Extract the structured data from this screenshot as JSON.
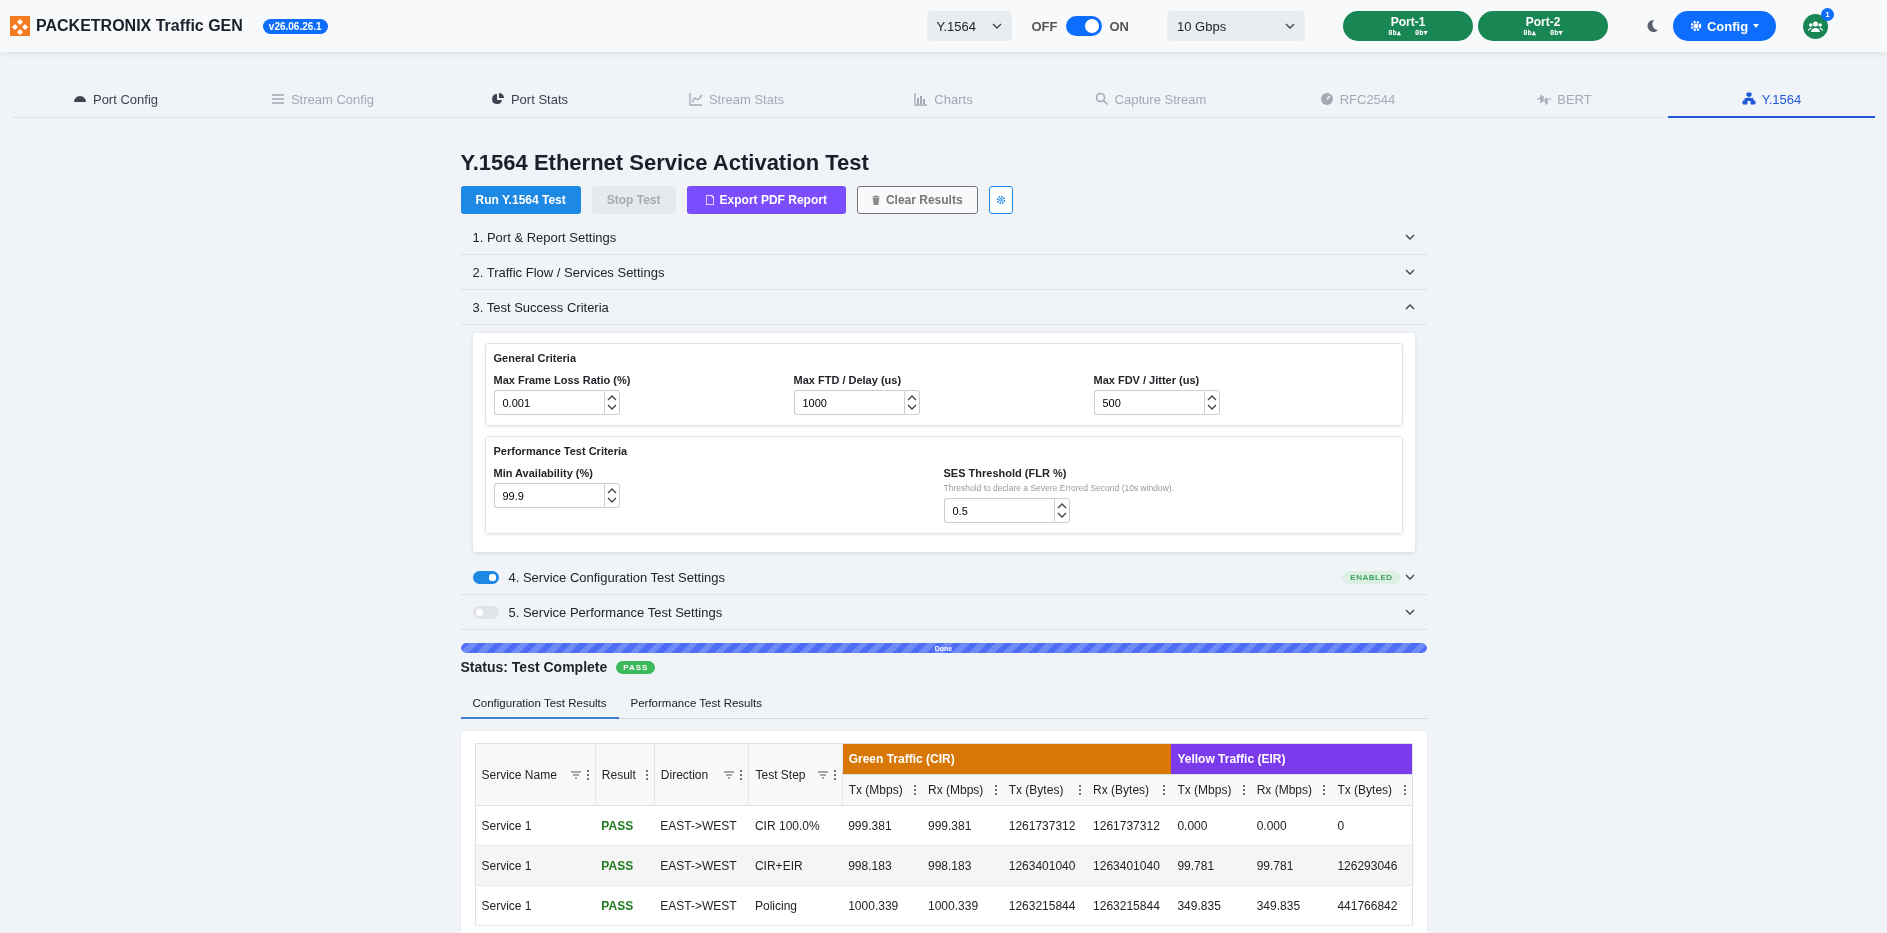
{
  "header": {
    "brand": "PACKETRONIX Traffic GEN",
    "version": "v26.06.26.1",
    "mode_select": "Y.1564",
    "power": {
      "off_label": "OFF",
      "on_label": "ON",
      "on": true
    },
    "speed_select": "10 Gbps",
    "ports": [
      {
        "name": "Port-1",
        "tx": "0b▲",
        "rx": "0b▼"
      },
      {
        "name": "Port-2",
        "tx": "0b▲",
        "rx": "0b▼"
      }
    ],
    "config_button": "Config",
    "notification_count": "1"
  },
  "tabs": [
    {
      "label": "Port Config",
      "selected": false,
      "disabled": false
    },
    {
      "label": "Stream Config",
      "selected": false,
      "disabled": true
    },
    {
      "label": "Port Stats",
      "selected": false,
      "disabled": false
    },
    {
      "label": "Stream Stats",
      "selected": false,
      "disabled": true
    },
    {
      "label": "Charts",
      "selected": false,
      "disabled": true
    },
    {
      "label": "Capture Stream",
      "selected": false,
      "disabled": true
    },
    {
      "label": "RFC2544",
      "selected": false,
      "disabled": true
    },
    {
      "label": "BERT",
      "selected": false,
      "disabled": true
    },
    {
      "label": "Y.1564",
      "selected": true,
      "disabled": false
    }
  ],
  "page": {
    "title": "Y.1564 Ethernet Service Activation Test",
    "buttons": [
      {
        "label": "Run Y.1564 Test",
        "kind": "primary"
      },
      {
        "label": "Stop Test",
        "kind": "disabled"
      },
      {
        "label": "Export PDF Report",
        "kind": "pdf"
      },
      {
        "label": "Clear Results",
        "kind": "clear"
      },
      {
        "kind": "settings"
      }
    ],
    "sections": [
      {
        "label": "1. Port & Report Settings",
        "expanded": false
      },
      {
        "label": "2. Traffic Flow / Services Settings",
        "expanded": false
      },
      {
        "label": "3. Test Success Criteria",
        "expanded": true,
        "groups": [
          {
            "title": "General Criteria",
            "fields": [
              {
                "label": "Max Frame Loss Ratio (%)",
                "value": "0.001"
              },
              {
                "label": "Max FTD / Delay (us)",
                "value": "1000"
              },
              {
                "label": "Max FDV / Jitter (us)",
                "value": "500"
              }
            ]
          },
          {
            "title": "Performance Test Criteria",
            "fields": [
              {
                "label": "Min Availability (%)",
                "value": "99.9"
              },
              {
                "label": "SES Threshold (FLR %)",
                "hint": "Threshold to declare a Severe Errored Second (10s window).",
                "value": "0.5"
              }
            ]
          }
        ]
      },
      {
        "label": "4. Service Configuration Test Settings",
        "expanded": false,
        "switch_on": true,
        "badge": "ENABLED"
      },
      {
        "label": "5. Service Performance Test Settings",
        "expanded": false,
        "switch_on": false
      }
    ],
    "progress": {
      "label": "Done",
      "level": 1
    },
    "status": {
      "label": "Status: Test Complete",
      "badge": "PASS"
    },
    "result_tabs": [
      {
        "label": "Configuration Test Results",
        "selected": true
      },
      {
        "label": "Performance Test Results",
        "selected": false
      }
    ],
    "table": {
      "groups": [
        {
          "label": "Green Traffic (CIR)",
          "color": "#d97706"
        },
        {
          "label": "Yellow Traffic (EIR)",
          "color": "#7c3aed"
        }
      ],
      "columns": [
        {
          "label": "Service Name",
          "filter": true,
          "kind": "text"
        },
        {
          "label": "Result",
          "filter": false,
          "kind": "result"
        },
        {
          "label": "Direction",
          "filter": true,
          "kind": "text"
        },
        {
          "label": "Test Step",
          "filter": true,
          "kind": "text"
        }
      ],
      "group_columns": [
        [
          "Tx (Mbps)",
          "Rx (Mbps)",
          "Tx (Bytes)",
          "Rx (Bytes)"
        ],
        [
          "Tx (Mbps)",
          "Rx (Mbps)",
          "Tx (Bytes)"
        ]
      ],
      "rows": [
        [
          "Service 1",
          "PASS",
          "EAST->WEST",
          "CIR 100.0%",
          "999.381",
          "999.381",
          "1261737312",
          "1261737312",
          "0.000",
          "0.000",
          "0"
        ],
        [
          "Service 1",
          "PASS",
          "EAST->WEST",
          "CIR+EIR",
          "998.183",
          "998.183",
          "1263401040",
          "1263401040",
          "99.781",
          "99.781",
          "126293046"
        ],
        [
          "Service 1",
          "PASS",
          "EAST->WEST",
          "Policing",
          "1000.339",
          "1000.339",
          "1263215844",
          "1263215844",
          "349.835",
          "349.835",
          "441766842"
        ]
      ]
    }
  }
}
